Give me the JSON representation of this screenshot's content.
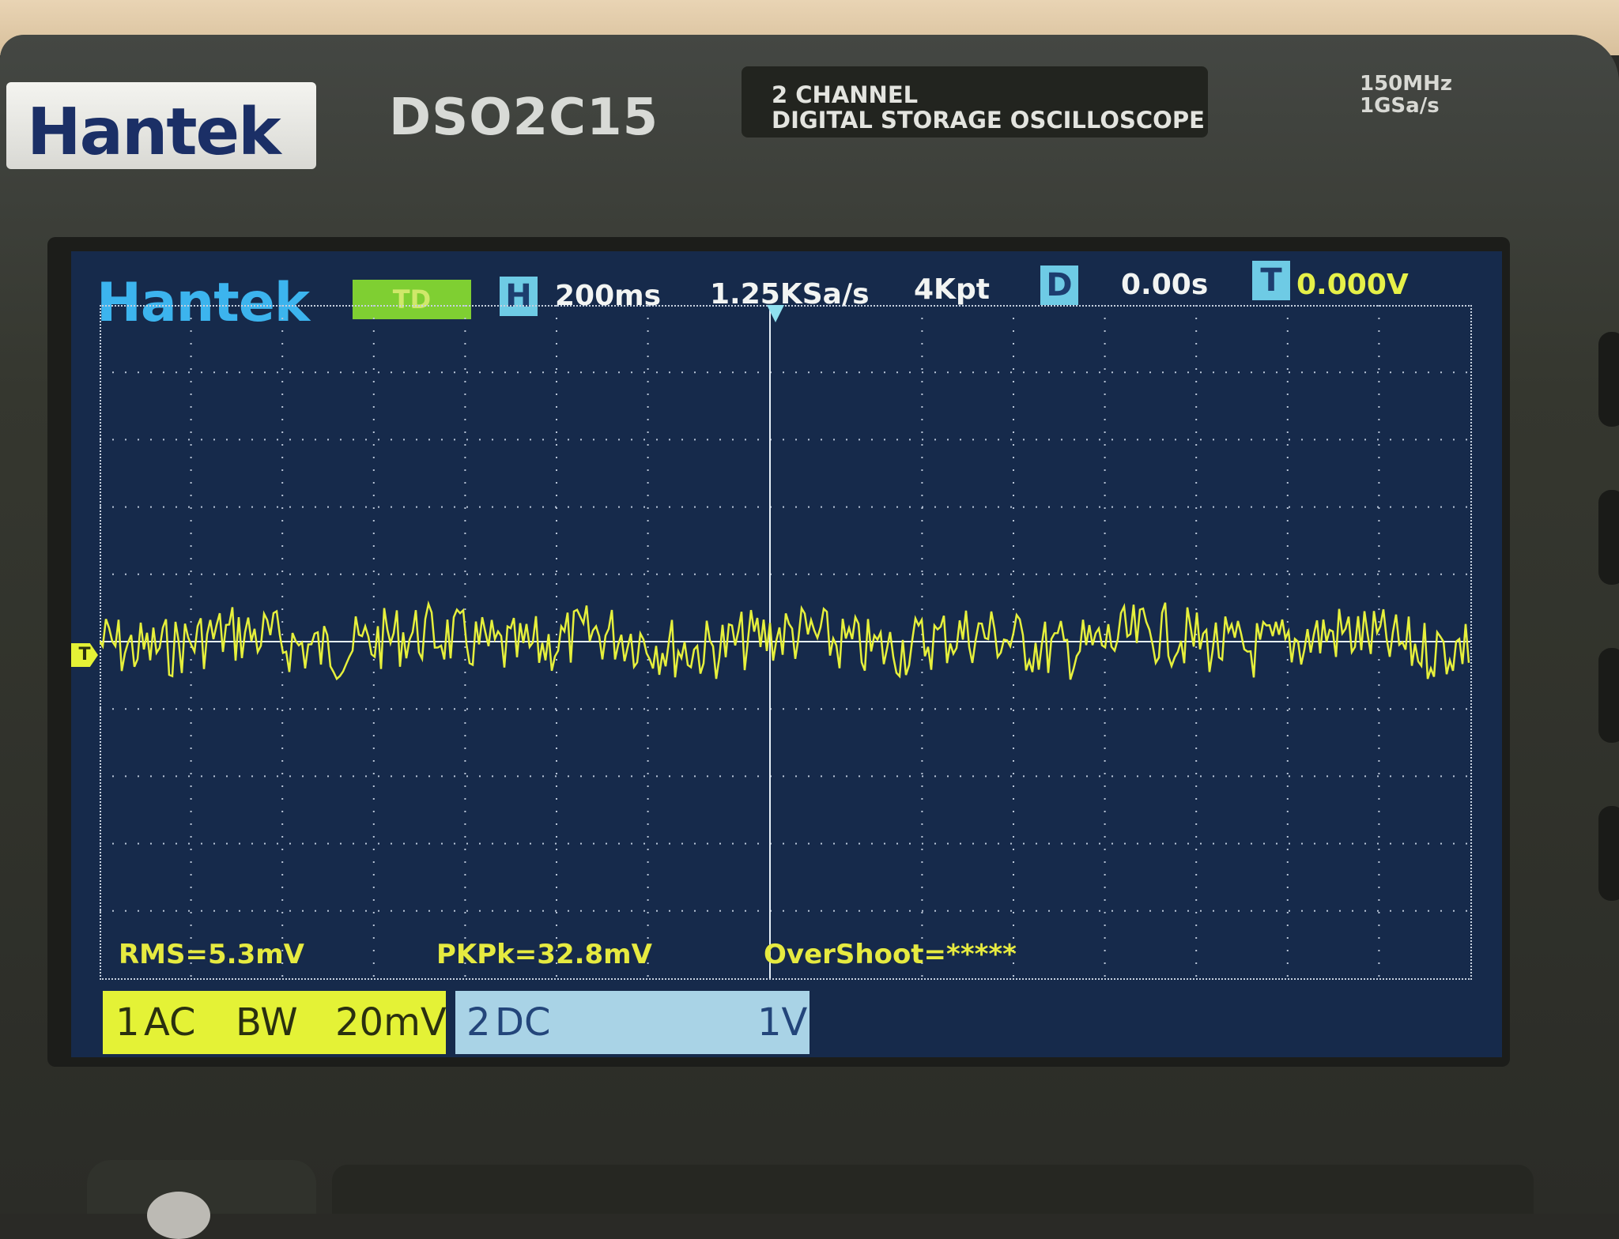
{
  "device": {
    "brand": "Hantek",
    "model": "DSO2C15",
    "description_line1": "2 CHANNEL",
    "description_line2": "DIGITAL STORAGE OSCILLOSCOPE",
    "spec_line1": "150MHz",
    "spec_line2": "1GSa/s"
  },
  "screen": {
    "logo": "Hantek",
    "mode": "TD",
    "h_label": "H",
    "timebase": "200ms",
    "sample_rate": "1.25KSa/s",
    "memory_depth": "4Kpt",
    "d_label": "D",
    "delay": "0.00s",
    "t_label": "T",
    "trigger_level": "0.000V",
    "trigger_marker": "T"
  },
  "measurements": {
    "rms": "RMS=5.3mV",
    "pkpk": "PKPk=32.8mV",
    "overshoot": "OverShoot=*****"
  },
  "channels": {
    "ch1": {
      "number": "1",
      "coupling": "AC",
      "bw": "BW",
      "scale": "20mV"
    },
    "ch2": {
      "number": "2",
      "coupling": "DC",
      "scale": "1V"
    }
  },
  "colors": {
    "screen_bg": "#162a4b",
    "ch1": "#e4f236",
    "ch2": "#a9d3e6",
    "accent": "#6ecbe5"
  }
}
